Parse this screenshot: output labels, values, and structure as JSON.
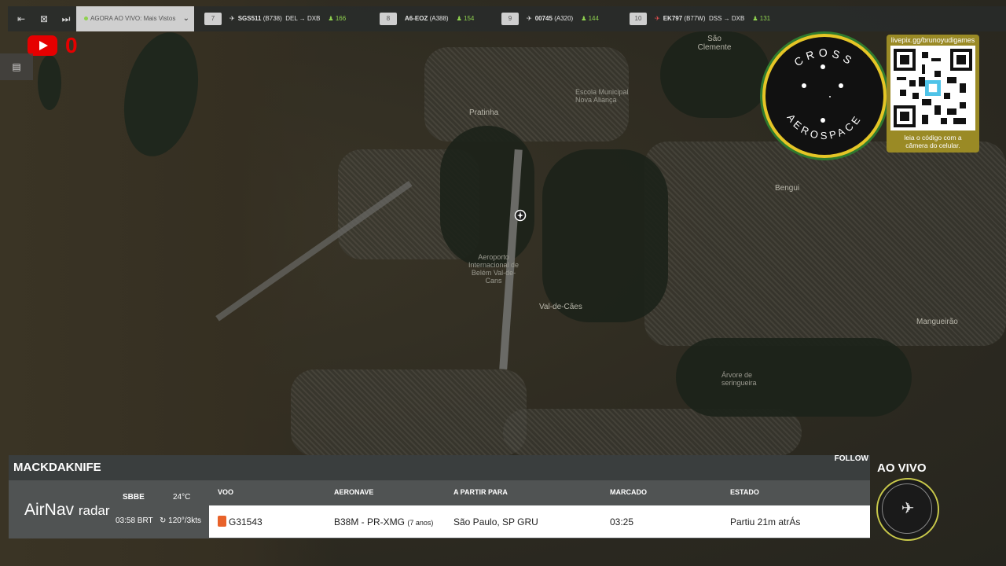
{
  "topbar": {
    "live_label": "AGORA AO VIVO:",
    "live_value": "Mais Vistos",
    "flights": [
      {
        "rank": "7",
        "callsign": "SGS511",
        "type": "(B738)",
        "from": "DEL",
        "to": "DXB",
        "viewers": "166"
      },
      {
        "rank": "8",
        "callsign": "A6-EOZ",
        "type": "(A388)",
        "from": "",
        "to": "",
        "viewers": "154"
      },
      {
        "rank": "9",
        "callsign": "00745",
        "type": "(A320)",
        "from": "",
        "to": "",
        "viewers": "144"
      },
      {
        "rank": "10",
        "callsign": "EK797",
        "type": "(B77W)",
        "from": "DSS",
        "to": "DXB",
        "viewers": "131"
      }
    ]
  },
  "youtube": {
    "count": "0"
  },
  "map": {
    "labels": [
      "São Clemente",
      "Pratinha",
      "Aeroporto Internacional de Belém Val-de-Cans",
      "Val-de-Cães",
      "Bengui",
      "Mangueirão",
      "Árvore de seringueira",
      "Escola Municipal Nova Aliança"
    ]
  },
  "badge": {
    "top_text": "CROSS",
    "bottom_text": "AEROSPACE"
  },
  "qr": {
    "url": "livepix.gg/brunoyudigames",
    "caption_line1": "leia o código com a",
    "caption_line2": "câmera do celular."
  },
  "panel": {
    "name": "MACKDAKNIFE",
    "follow": "FOLLOW",
    "brand_main": "AirNav",
    "brand_sub": "radar",
    "airport": "SBBE",
    "local_time": "03:58 BRT",
    "temperature": "24°C",
    "wind": "120°/3kts",
    "columns": {
      "flight": "VOO",
      "aircraft": "AERONAVE",
      "route": "A PARTIR PARA",
      "scheduled": "MARCADO",
      "status": "ESTADO"
    },
    "row": {
      "flight": "G31543",
      "aircraft": "B38M - PR-XMG",
      "aircraft_age": "(7 anos)",
      "route": "São Paulo, SP GRU",
      "scheduled": "03:25",
      "status": "Partiu 21m atrÁs"
    }
  },
  "live": {
    "label": "AO VIVO"
  },
  "colors": {
    "accent_green": "#8fd14f",
    "youtube_red": "#e60000",
    "badge_yellow": "#e5c526"
  }
}
